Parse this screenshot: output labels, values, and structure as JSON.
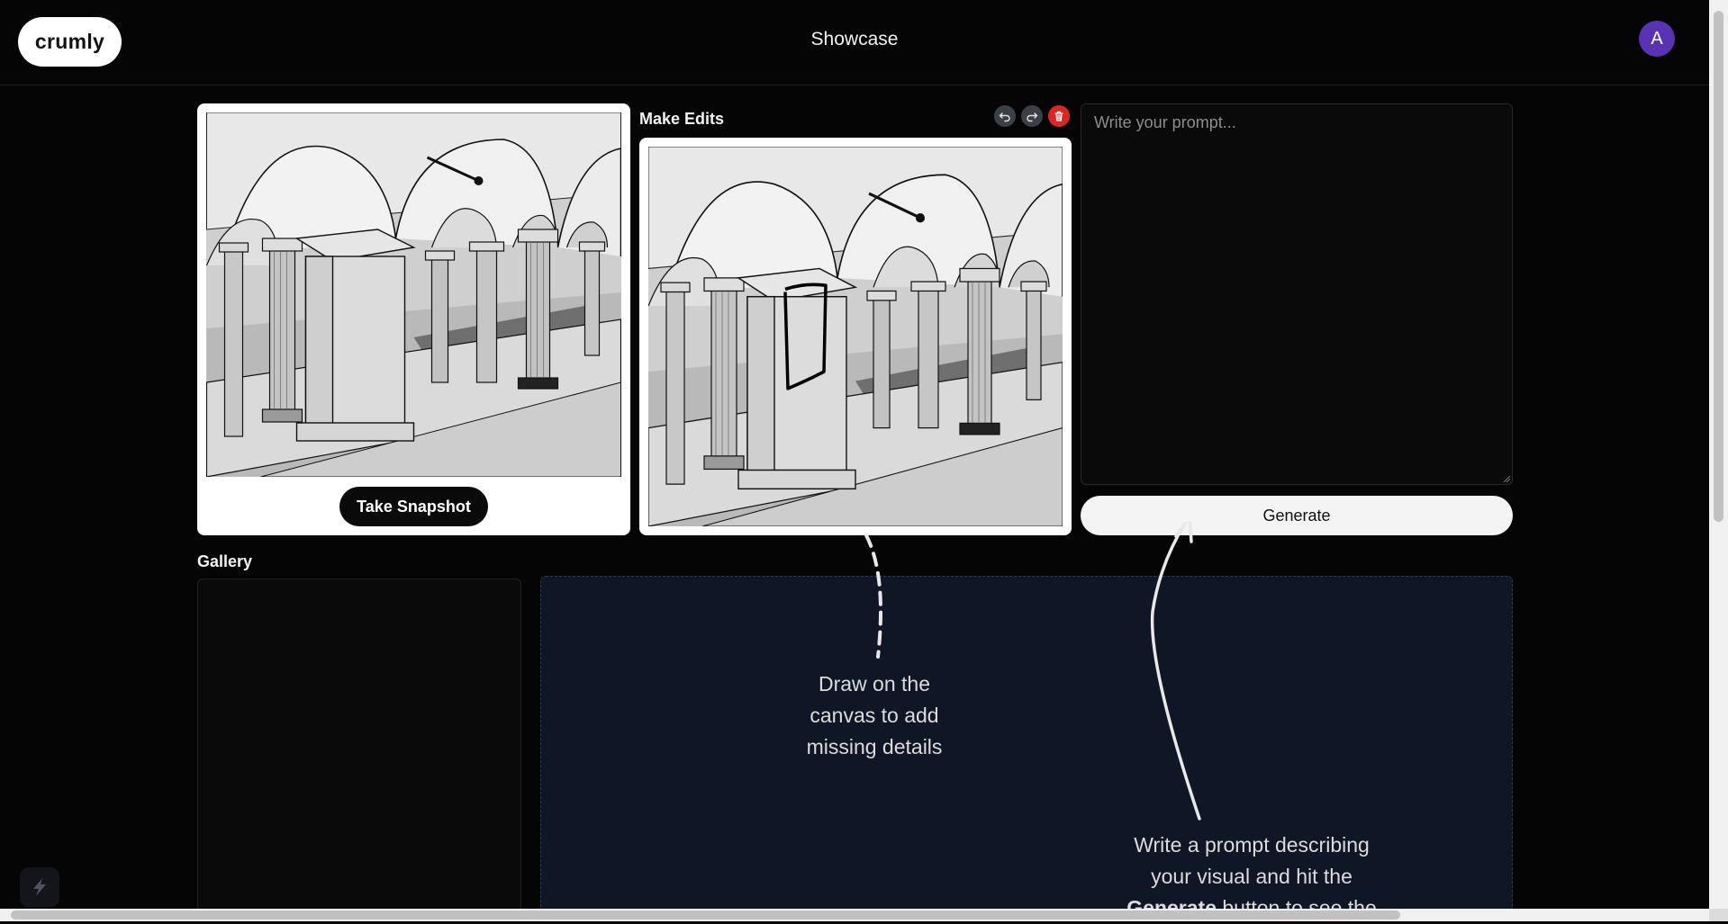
{
  "app": {
    "logo": "crumly",
    "title": "Showcase",
    "avatar_initial": "A"
  },
  "snapshot": {
    "button_label": "Take Snapshot"
  },
  "edits": {
    "label": "Make Edits",
    "tools": [
      {
        "name": "undo",
        "icon": "undo-icon"
      },
      {
        "name": "redo",
        "icon": "redo-icon"
      },
      {
        "name": "clear",
        "icon": "trash-icon"
      }
    ]
  },
  "prompt": {
    "placeholder": "Write your prompt...",
    "value": ""
  },
  "generate": {
    "label": "Generate"
  },
  "gallery": {
    "label": "Gallery"
  },
  "onboarding": {
    "draw_hint": [
      "Draw on the",
      "canvas to add",
      "missing details"
    ],
    "prompt_hint_line1": "Write a prompt describing",
    "prompt_hint_line2": "your visual and hit the",
    "prompt_hint_bold": "Generate",
    "prompt_hint_rest": " button to see the"
  },
  "colors": {
    "avatar": "#5a33b5",
    "delete": "#dc2626",
    "background": "#050505",
    "onboarding_bg": "#0f1625"
  }
}
